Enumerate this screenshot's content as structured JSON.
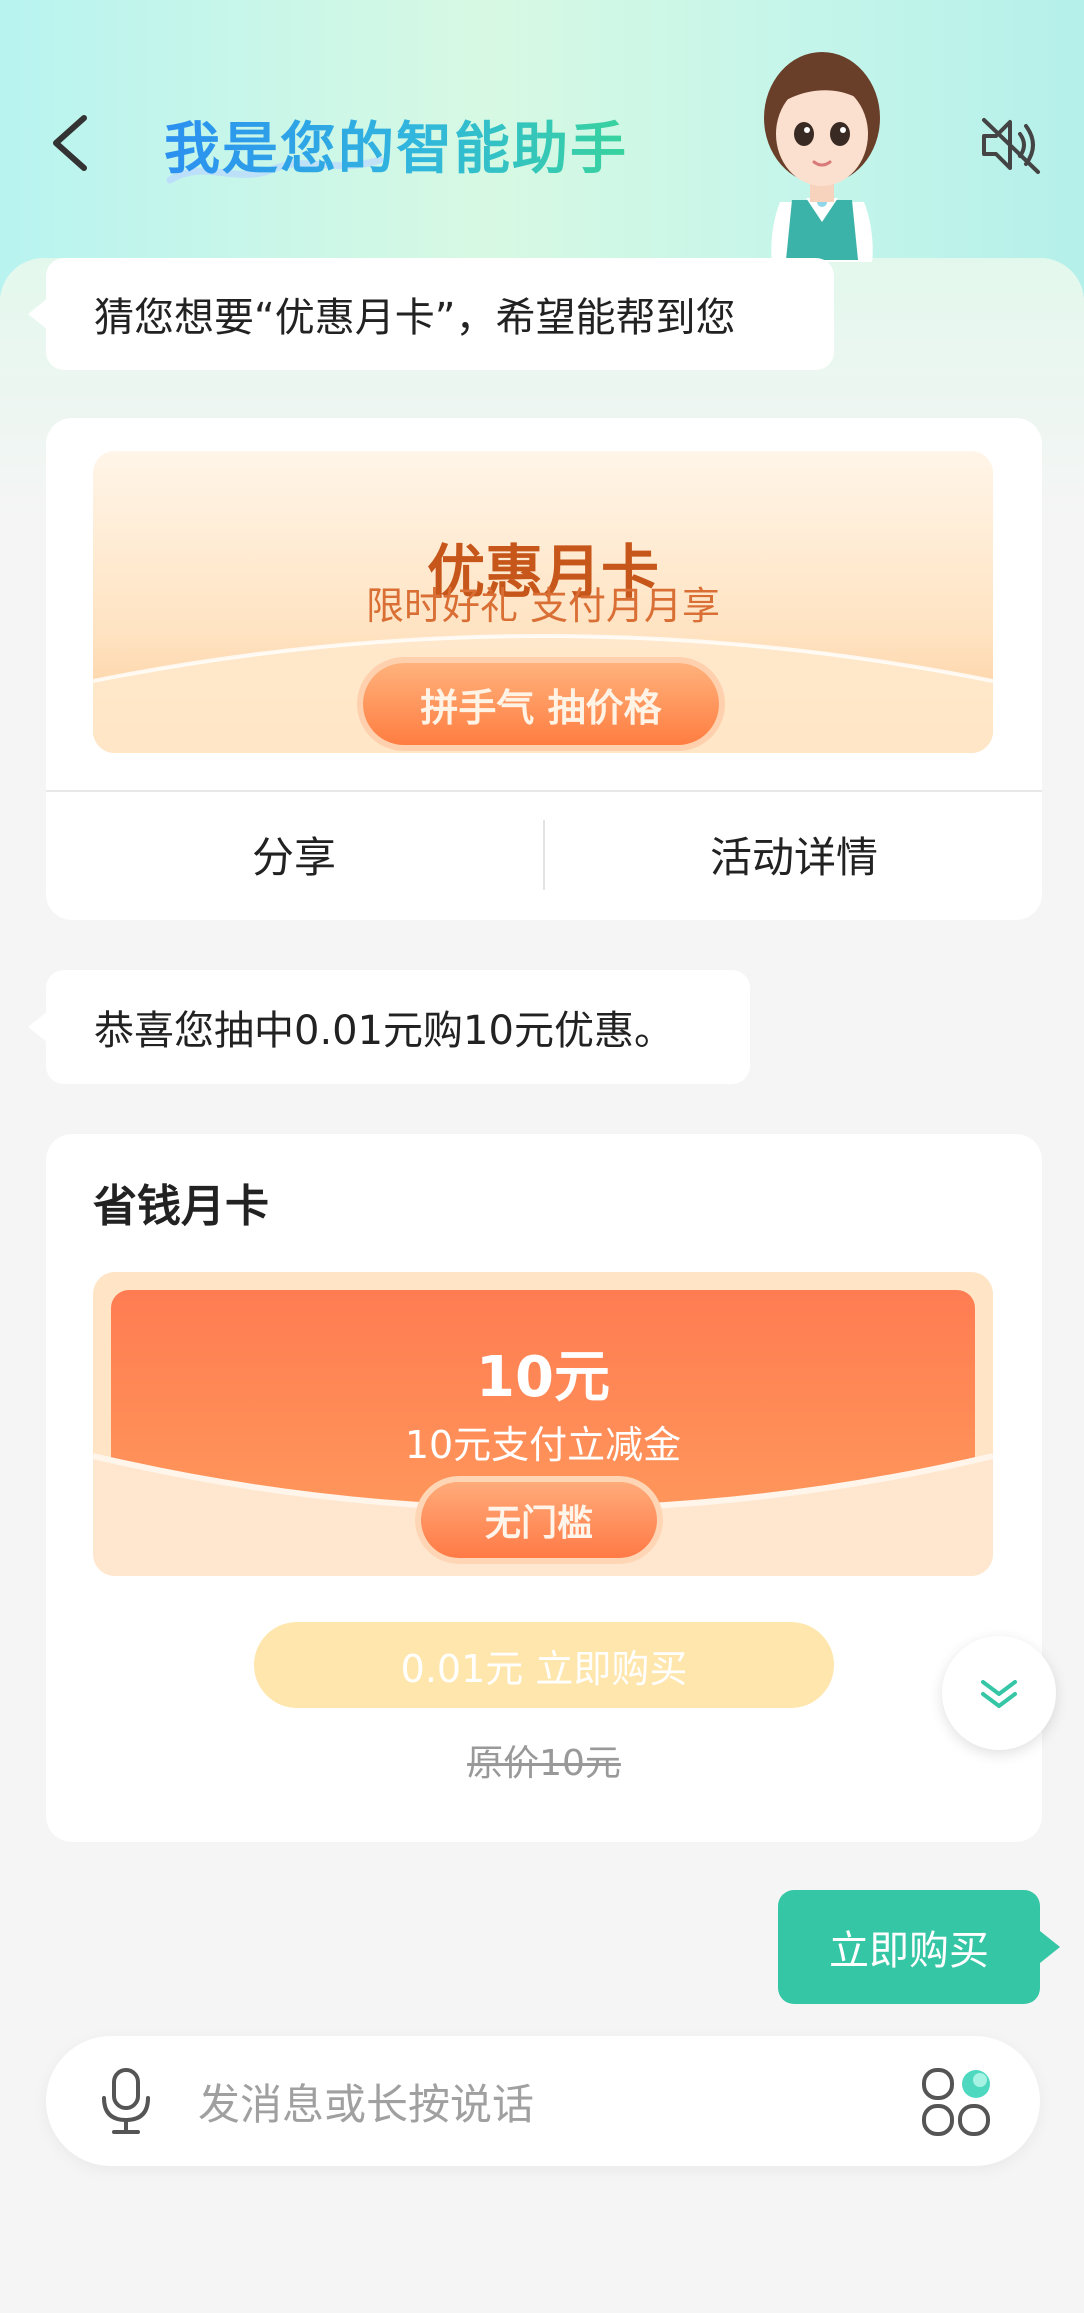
{
  "header": {
    "title": "我是您的智能助手"
  },
  "messages": {
    "bot_1": "猜您想要“优惠月卡”，希望能帮到您",
    "bot_2": "恭喜您抽中0.01元购10元优惠。",
    "user_1": "立即购买"
  },
  "promo_card": {
    "title": "优惠月卡",
    "subtitle": "限时好礼 支付月月享",
    "button": "拼手气 抽价格",
    "share": "分享",
    "details": "活动详情"
  },
  "coupon_card": {
    "title": "省钱月卡",
    "amount": "10元",
    "description": "10元支付立减金",
    "tag": "无门槛",
    "buy_button": "0.01元 立即购买",
    "original_price": "原价10元"
  },
  "input": {
    "placeholder": "发消息或长按说话"
  },
  "colors": {
    "accent_green": "#35c6a5",
    "promo_orange": "#ff7c52",
    "title_blue": "#2b8ff0"
  },
  "icons": [
    "back-arrow-icon",
    "mute-icon",
    "microphone-icon",
    "apps-icon",
    "chevron-down-double-icon"
  ]
}
